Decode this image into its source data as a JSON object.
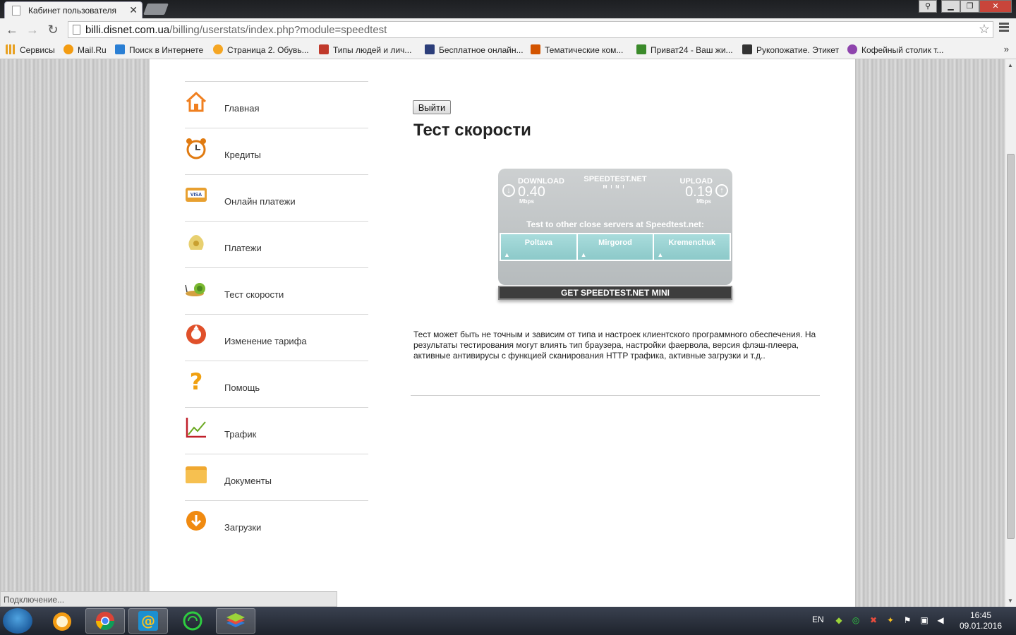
{
  "browser": {
    "tab_title": "Кабинет пользователя",
    "url_host": "billi.disnet.com.ua",
    "url_path": "/billing/userstats/index.php?module=speedtest",
    "bookmarks": [
      {
        "label": "Сервисы",
        "color": "#e8a020"
      },
      {
        "label": "Mail.Ru",
        "color": "#f39c12"
      },
      {
        "label": "Поиск в Интернете",
        "color": "#2a7fd4"
      },
      {
        "label": "Страница 2. Обувь...",
        "color": "#f5a623"
      },
      {
        "label": "Типы людей и лич...",
        "color": "#c0392b"
      },
      {
        "label": "Бесплатное онлайн...",
        "color": "#2c3e7a"
      },
      {
        "label": "Тематические ком...",
        "color": "#d35400"
      },
      {
        "label": "Приват24 - Ваш жи...",
        "color": "#3a8a2a"
      },
      {
        "label": "Рукопожатие. Этикет",
        "color": "#333333"
      },
      {
        "label": "Кофейный столик т...",
        "color": "#8e44ad"
      }
    ],
    "bookmarks_more": "»",
    "status_text": "Подключение..."
  },
  "sidebar": {
    "items": [
      {
        "label": "Главная",
        "icon": "home-icon"
      },
      {
        "label": "Кредиты",
        "icon": "alarm-clock-icon"
      },
      {
        "label": "Онлайн платежи",
        "icon": "credit-card-icon"
      },
      {
        "label": "Платежи",
        "icon": "money-bag-icon"
      },
      {
        "label": "Тест скорости",
        "icon": "snail-icon"
      },
      {
        "label": "Изменение тарифа",
        "icon": "tariff-change-icon"
      },
      {
        "label": "Помощь",
        "icon": "question-icon"
      },
      {
        "label": "Трафик",
        "icon": "chart-icon"
      },
      {
        "label": "Документы",
        "icon": "folder-icon"
      },
      {
        "label": "Загрузки",
        "icon": "download-icon"
      }
    ]
  },
  "main": {
    "logout_label": "Выйти",
    "title": "Тест скорости",
    "description": "Тест может быть не точным и зависим от типа и настроек клиентского программного обеспечения. На результаты тестирования могут влиять тип браузера, настройки фаервола, версия флэш-плеера, активные антивирусы с функцией сканирования HTTP трафика, активные загрузки и т.д.."
  },
  "speedtest": {
    "download_label": "DOWNLOAD",
    "download_value": "0.40",
    "download_unit": "Mbps",
    "upload_label": "UPLOAD",
    "upload_value": "0.19",
    "upload_unit": "Mbps",
    "logo_text": "SPEEDTEST.NET",
    "logo_sub": "MINI",
    "prompt": "Test to other close servers at Speedtest.net:",
    "servers": [
      "Poltava",
      "Mirgorod",
      "Kremenchuk"
    ],
    "footer": "GET SPEEDTEST.NET MINI"
  },
  "taskbar": {
    "lang": "EN",
    "time": "16:45",
    "date": "09.01.2016"
  }
}
